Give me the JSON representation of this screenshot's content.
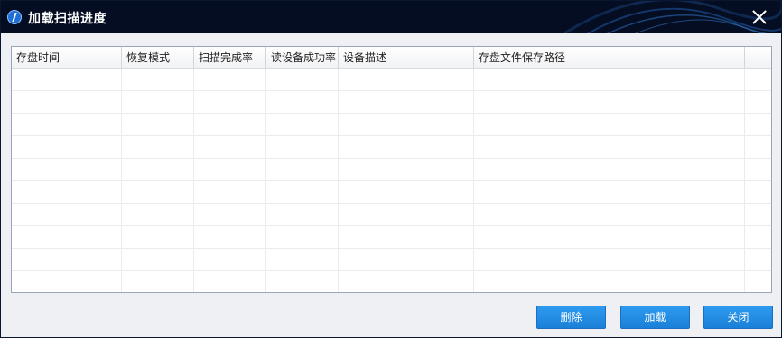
{
  "window": {
    "title": "加载扫描进度"
  },
  "table": {
    "columns": [
      "存盘时间",
      "恢复模式",
      "扫描完成率",
      "读设备成功率",
      "设备描述",
      "存盘文件保存路径"
    ],
    "rows": []
  },
  "buttons": {
    "delete_label": "删除",
    "load_label": "加载",
    "close_label": "关闭"
  },
  "colors": {
    "titlebar": "#050d22",
    "button": "#2084e0"
  }
}
